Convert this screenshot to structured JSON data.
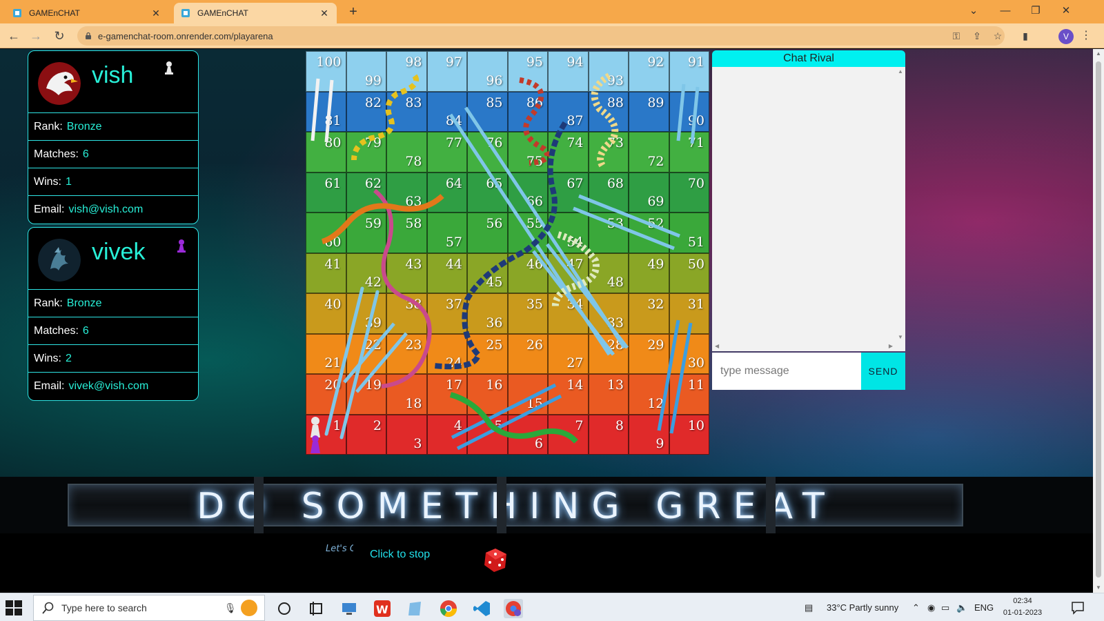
{
  "browser": {
    "tabs": [
      {
        "title": "GAMEnCHAT",
        "active": false
      },
      {
        "title": "GAMEnCHAT",
        "active": true
      }
    ],
    "url": "e-gamenchat-room.onrender.com/playarena",
    "profile_initial": "V"
  },
  "players": [
    {
      "name": "vish",
      "rank_label": "Rank:",
      "rank": "Bronze",
      "matches_label": "Matches:",
      "matches": "6",
      "wins_label": "Wins:",
      "wins": "1",
      "email_label": "Email:",
      "email": "vish@vish.com",
      "pawn_color": "#e8e8e8",
      "avatar_icon": "eagle-avatar"
    },
    {
      "name": "vivek",
      "rank_label": "Rank:",
      "rank": "Bronze",
      "matches_label": "Matches:",
      "matches": "6",
      "wins_label": "Wins:",
      "wins": "2",
      "email_label": "Email:",
      "email": "vivek@vish.com",
      "pawn_color": "#9b2ad8",
      "avatar_icon": "dragon-avatar"
    }
  ],
  "board": {
    "rows": [
      {
        "color": "#e02a2a",
        "cells": [
          "1",
          "2",
          "3",
          "4",
          "5",
          "6",
          "7",
          "8",
          "9",
          "10"
        ]
      },
      {
        "color": "#ea5a22",
        "cells": [
          "20",
          "19",
          "18",
          "17",
          "16",
          "15",
          "14",
          "13",
          "12",
          "11"
        ]
      },
      {
        "color": "#f08a18",
        "cells": [
          "21",
          "22",
          "23",
          "24",
          "25",
          "26",
          "27",
          "28",
          "29",
          "30"
        ]
      },
      {
        "color": "#c99a1c",
        "cells": [
          "40",
          "39",
          "38",
          "37",
          "36",
          "35",
          "34",
          "33",
          "32",
          "31"
        ]
      },
      {
        "color": "#8aa626",
        "cells": [
          "41",
          "42",
          "43",
          "44",
          "45",
          "46",
          "47",
          "48",
          "49",
          "50"
        ]
      },
      {
        "color": "#3aa83a",
        "cells": [
          "60",
          "59",
          "58",
          "57",
          "56",
          "55",
          "54",
          "53",
          "52",
          "51"
        ]
      },
      {
        "color": "#2f9e44",
        "cells": [
          "61",
          "62",
          "63",
          "64",
          "65",
          "66",
          "67",
          "68",
          "69",
          "70"
        ]
      },
      {
        "color": "#42b041",
        "cells": [
          "80",
          "79",
          "78",
          "77",
          "76",
          "75",
          "74",
          "73",
          "72",
          "71"
        ]
      },
      {
        "color": "#2a78c8",
        "cells": [
          "81",
          "82",
          "83",
          "84",
          "85",
          "86",
          "87",
          "88",
          "89",
          "90"
        ]
      },
      {
        "color": "#8ed0ee",
        "cells": [
          "100",
          "99",
          "98",
          "97",
          "96",
          "95",
          "94",
          "93",
          "92",
          "91"
        ]
      }
    ],
    "ladder_color": "#7fc6e8",
    "player1_position": "1",
    "player2_position": "1"
  },
  "chat": {
    "title": "Chat Rival",
    "input_placeholder": "type message",
    "send_label": "SEND"
  },
  "banner": {
    "text": "DO SOMETHING GREAT"
  },
  "controls": {
    "letsgo_logo": "Let's GO",
    "stop_label": "Click to stop",
    "dice_icon": "dice-icon"
  },
  "taskbar": {
    "search_placeholder": "Type here to search",
    "weather": "33°C  Partly sunny",
    "language": "ENG",
    "time": "02:34",
    "date": "01-01-2023"
  }
}
